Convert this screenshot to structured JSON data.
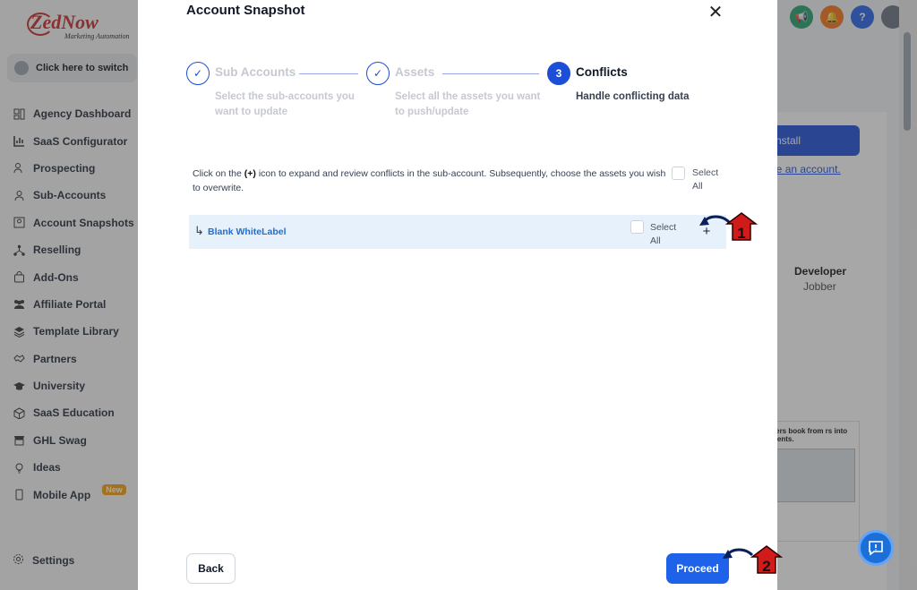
{
  "app": {
    "logo_text": "ZedNow",
    "logo_tagline": "Marketing Automation",
    "switch_label": "Click here to switch",
    "nav": [
      {
        "label": "Agency Dashboard",
        "icon": "dashboard-icon"
      },
      {
        "label": "SaaS Configurator",
        "icon": "chart-icon"
      },
      {
        "label": "Prospecting",
        "icon": "people-icon"
      },
      {
        "label": "Sub-Accounts",
        "icon": "user-icon"
      },
      {
        "label": "Account Snapshots",
        "icon": "snapshot-icon"
      },
      {
        "label": "Reselling",
        "icon": "network-icon"
      },
      {
        "label": "Add-Ons",
        "icon": "bag-icon"
      },
      {
        "label": "Affiliate Portal",
        "icon": "group-icon"
      },
      {
        "label": "Template Library",
        "icon": "stack-icon"
      },
      {
        "label": "Partners",
        "icon": "handshake-icon"
      },
      {
        "label": "University",
        "icon": "graduation-icon"
      },
      {
        "label": "SaaS Education",
        "icon": "cube-icon"
      },
      {
        "label": "GHL Swag",
        "icon": "store-icon"
      },
      {
        "label": "Ideas",
        "icon": "bulb-icon"
      },
      {
        "label": "Mobile App",
        "icon": "mobile-icon",
        "badge": "New"
      }
    ],
    "settings_label": "Settings",
    "right": {
      "install_label": "Install",
      "create_account_link": "eate an account.",
      "developer_title": "Developer",
      "developer_name": "Jobber",
      "promo_text": "mers book from rs into clients."
    },
    "colors": {
      "primary": "#1d4ed8",
      "green": "#22a06b",
      "orange": "#f97316",
      "blue": "#2563eb"
    }
  },
  "modal": {
    "title": "Account Snapshot",
    "steps": [
      {
        "marker": "✓",
        "title": "Sub Accounts",
        "desc": "Select the sub-accounts you want to update",
        "state": "done"
      },
      {
        "marker": "✓",
        "title": "Assets",
        "desc": "Select all the assets you want to push/update",
        "state": "done"
      },
      {
        "marker": "3",
        "title": "Conflicts",
        "desc": "Handle conflicting data",
        "state": "active"
      }
    ],
    "instruction_pre": "Click on the ",
    "instruction_bold": "(+)",
    "instruction_post": " icon to expand and review conflicts in the sub-account. Subsequently, choose the assets you wish to overwrite.",
    "select_all_label": "Select All",
    "rows": [
      {
        "name": "Blank WhiteLabel",
        "select_label": "Select All",
        "expand": "+"
      }
    ],
    "back_label": "Back",
    "proceed_label": "Proceed"
  },
  "annotations": [
    {
      "number": "1"
    },
    {
      "number": "2"
    }
  ]
}
